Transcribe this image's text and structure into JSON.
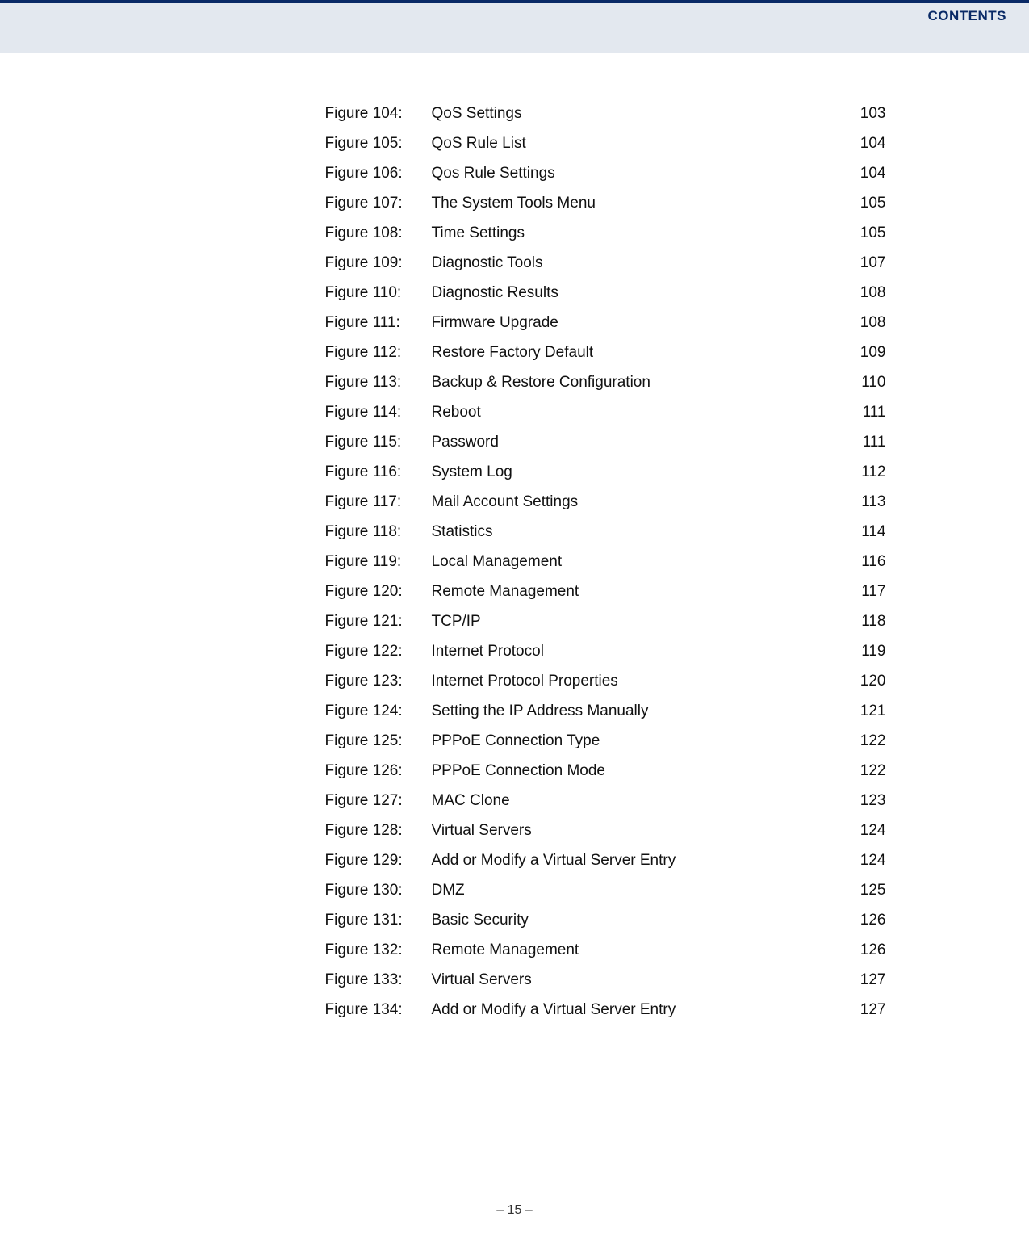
{
  "header": {
    "title": "CONTENTS"
  },
  "footer": {
    "left_dash": "–",
    "page_number": "15",
    "right_dash": "–"
  },
  "toc": {
    "entries": [
      {
        "label": "Figure 104:",
        "title": "QoS Settings",
        "page": "103"
      },
      {
        "label": "Figure 105:",
        "title": "QoS Rule List",
        "page": "104"
      },
      {
        "label": "Figure 106:",
        "title": "Qos Rule Settings",
        "page": "104"
      },
      {
        "label": "Figure 107:",
        "title": "The System Tools Menu",
        "page": "105"
      },
      {
        "label": "Figure 108:",
        "title": "Time Settings",
        "page": "105"
      },
      {
        "label": "Figure 109:",
        "title": "Diagnostic Tools",
        "page": "107"
      },
      {
        "label": "Figure 110:",
        "title": "Diagnostic Results",
        "page": "108"
      },
      {
        "label": "Figure 111:",
        "title": "Firmware Upgrade",
        "page": "108"
      },
      {
        "label": "Figure 112:",
        "title": "Restore Factory Default",
        "page": "109"
      },
      {
        "label": "Figure 113:",
        "title": "Backup & Restore Configuration",
        "page": "110"
      },
      {
        "label": "Figure 114:",
        "title": "Reboot",
        "page": "111"
      },
      {
        "label": "Figure 115:",
        "title": "Password",
        "page": "111"
      },
      {
        "label": "Figure 116:",
        "title": "System Log",
        "page": "112"
      },
      {
        "label": "Figure 117:",
        "title": "Mail Account Settings",
        "page": "113"
      },
      {
        "label": "Figure 118:",
        "title": "Statistics",
        "page": "114"
      },
      {
        "label": "Figure 119:",
        "title": "Local Management",
        "page": "116"
      },
      {
        "label": "Figure 120:",
        "title": "Remote Management",
        "page": "117"
      },
      {
        "label": "Figure 121:",
        "title": "TCP/IP",
        "page": "118"
      },
      {
        "label": "Figure 122:",
        "title": "Internet Protocol",
        "page": "119"
      },
      {
        "label": "Figure 123:",
        "title": "Internet Protocol Properties",
        "page": "120"
      },
      {
        "label": "Figure 124:",
        "title": "Setting the IP Address Manually",
        "page": "121"
      },
      {
        "label": "Figure 125:",
        "title": "PPPoE Connection Type",
        "page": "122"
      },
      {
        "label": "Figure 126:",
        "title": "PPPoE Connection Mode",
        "page": "122"
      },
      {
        "label": "Figure 127:",
        "title": "MAC Clone",
        "page": "123"
      },
      {
        "label": "Figure 128:",
        "title": "Virtual Servers",
        "page": "124"
      },
      {
        "label": "Figure 129:",
        "title": "Add or Modify a Virtual Server Entry",
        "page": "124"
      },
      {
        "label": "Figure 130:",
        "title": "DMZ",
        "page": "125"
      },
      {
        "label": "Figure 131:",
        "title": "Basic Security",
        "page": "126"
      },
      {
        "label": "Figure 132:",
        "title": "Remote Management",
        "page": "126"
      },
      {
        "label": "Figure 133:",
        "title": "Virtual Servers",
        "page": "127"
      },
      {
        "label": "Figure 134:",
        "title": "Add or Modify a Virtual Server Entry",
        "page": "127"
      }
    ]
  }
}
